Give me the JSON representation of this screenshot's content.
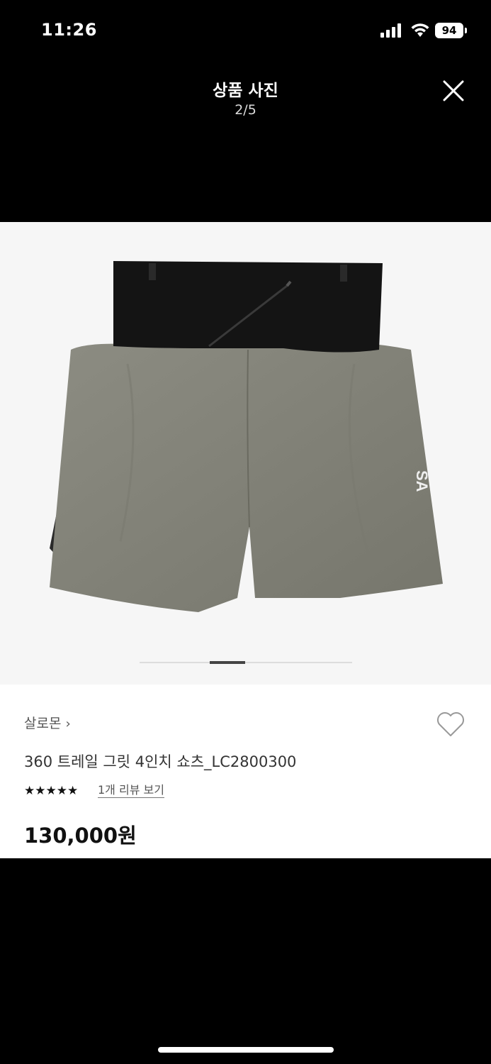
{
  "status_bar": {
    "time": "11:26",
    "battery": "94"
  },
  "header": {
    "title": "상품 사진",
    "counter": "2/5"
  },
  "product": {
    "brand": "살로몬",
    "name": "360 트레일 그릿 4인치 쇼츠_LC2800300",
    "rating_stars": "★★★★★",
    "review_link": "1개 리뷰 보기",
    "price": "130,000원"
  },
  "gallery": {
    "current_index": 2,
    "total": 5
  },
  "colors": {
    "shorts": "#84847a",
    "waistband": "#141414",
    "background": "#000000"
  }
}
